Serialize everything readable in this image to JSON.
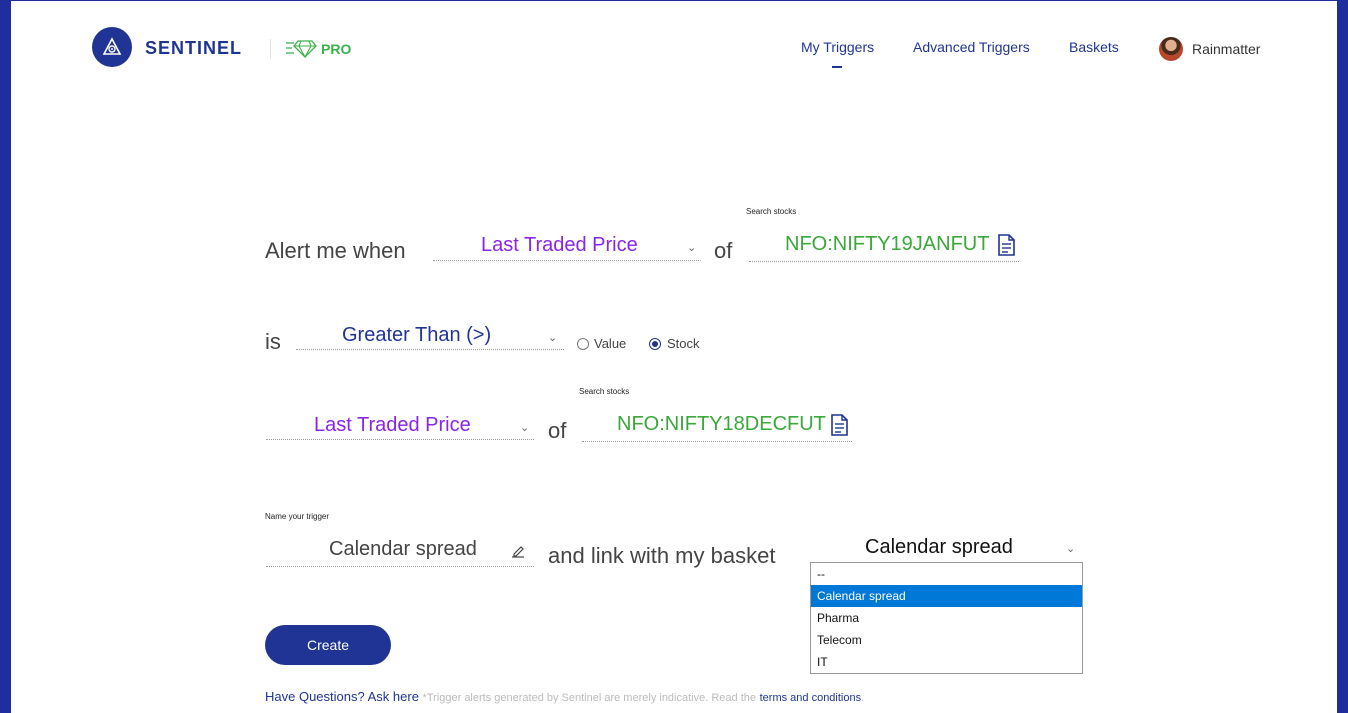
{
  "header": {
    "brand": "SENTINEL",
    "pro_label": "PRO",
    "nav": [
      {
        "label": "My Triggers"
      },
      {
        "label": "Advanced Triggers"
      },
      {
        "label": "Baskets"
      }
    ],
    "user": "Rainmatter"
  },
  "form": {
    "row1": {
      "prefix": "Alert me when",
      "attribute": "Last Traded Price",
      "of": "of",
      "search_label": "Search stocks",
      "stock": "NFO:NIFTY19JANFUT"
    },
    "row2": {
      "prefix": "is",
      "condition": "Greater Than (>)",
      "radio_value": "Value",
      "radio_stock": "Stock",
      "selected": "Stock"
    },
    "row3": {
      "attribute": "Last Traded Price",
      "of": "of",
      "search_label": "Search stocks",
      "stock": "NFO:NIFTY18DECFUT"
    },
    "row4": {
      "name_label": "Name your trigger",
      "name_value": "Calendar spread",
      "link_text": "and link with my basket",
      "basket_value": "Calendar spread",
      "basket_options": [
        "--",
        "Calendar spread",
        "Pharma",
        "Telecom",
        "IT"
      ],
      "highlighted_option": "Calendar spread"
    },
    "create_label": "Create"
  },
  "footer": {
    "question": "Have Questions? Ask here",
    "disclaimer": "*Trigger alerts generated by Sentinel are merely indicative. Read the",
    "terms": "terms and conditions",
    "end": "."
  },
  "colors": {
    "brand": "#1f3494",
    "attribute": "#8a24e6",
    "stock": "#3aa83a",
    "pro": "#38b24a",
    "highlight": "#0078d7"
  }
}
